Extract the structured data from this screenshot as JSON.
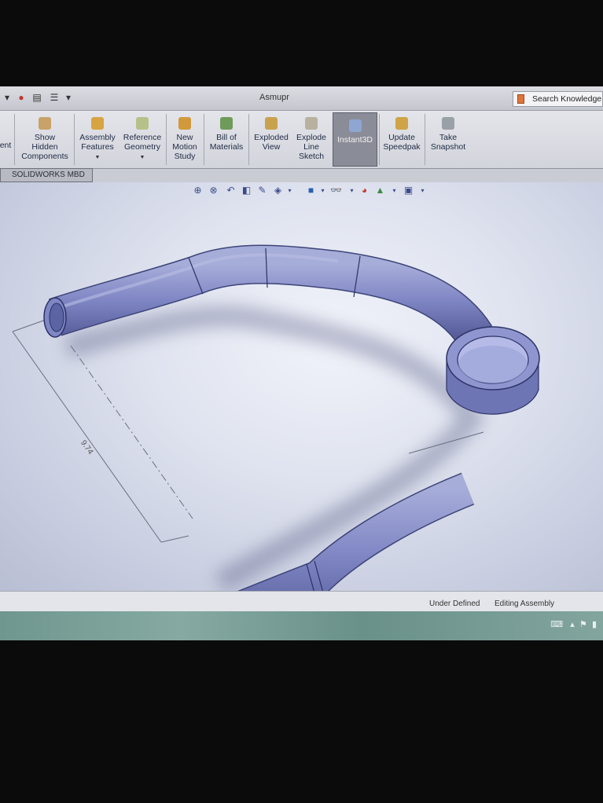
{
  "window": {
    "title": "Asmupr"
  },
  "search": {
    "placeholder": "Search Knowledge"
  },
  "ribbon": {
    "items": [
      {
        "label": "ent",
        "icon": "cut-off-icon"
      },
      {
        "label": "Show\nHidden\nComponents",
        "icon": "show-hidden-icon"
      },
      {
        "label": "Assembly\nFeatures",
        "icon": "assembly-features-icon"
      },
      {
        "label": "Reference\nGeometry",
        "icon": "reference-geometry-icon"
      },
      {
        "label": "New\nMotion\nStudy",
        "icon": "motion-study-icon"
      },
      {
        "label": "Bill of\nMaterials",
        "icon": "bom-icon"
      },
      {
        "label": "Exploded\nView",
        "icon": "exploded-view-icon"
      },
      {
        "label": "Explode\nLine\nSketch",
        "icon": "explode-line-icon"
      },
      {
        "label": "Instant3D",
        "icon": "instant3d-icon"
      },
      {
        "label": "Update\nSpeedpak",
        "icon": "speedpak-icon"
      },
      {
        "label": "Take\nSnapshot",
        "icon": "snapshot-icon"
      }
    ]
  },
  "tabs": {
    "mbd": "SOLIDWORKS MBD"
  },
  "dimension": {
    "value": "9.74"
  },
  "status": {
    "state": "Under Defined",
    "mode": "Editing Assembly"
  },
  "colors": {
    "part": "#7f86c4",
    "accent": "#3b4a8a"
  }
}
